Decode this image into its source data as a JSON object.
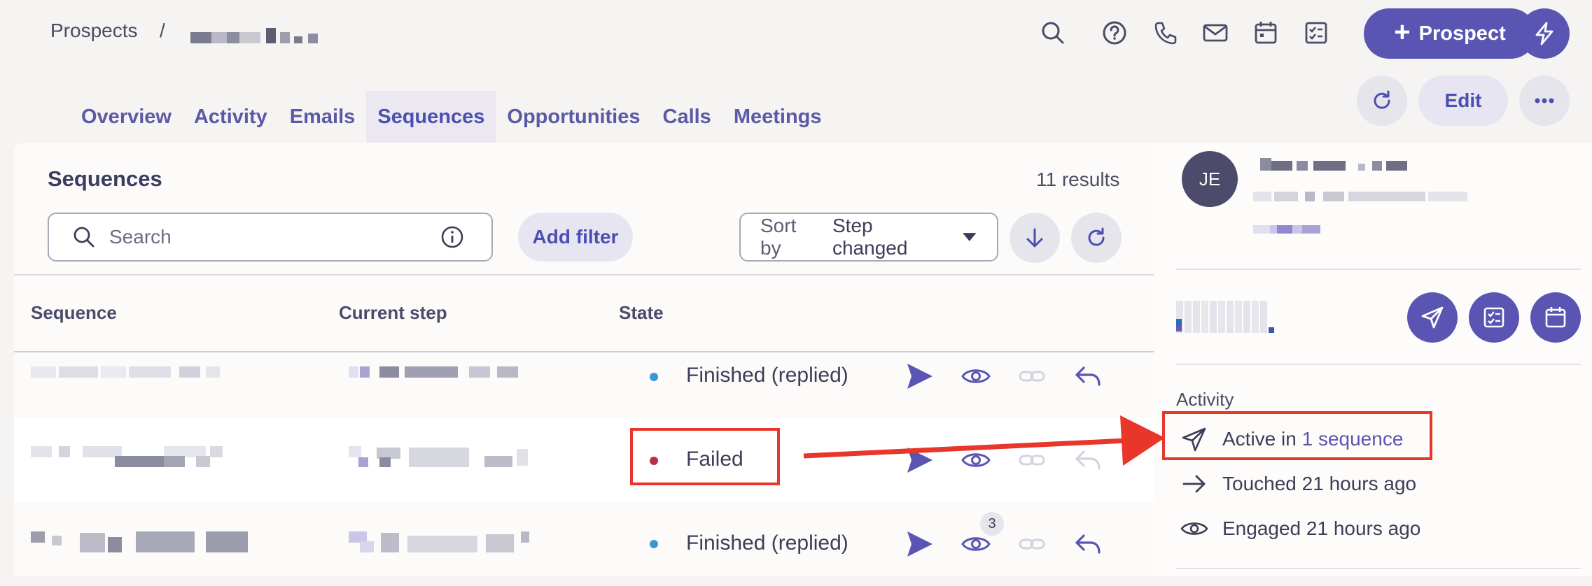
{
  "breadcrumb": {
    "parent": "Prospects",
    "separator": "/"
  },
  "header": {
    "prospect_button": "Prospect",
    "edit_button": "Edit"
  },
  "tabs": [
    {
      "label": "Overview"
    },
    {
      "label": "Activity"
    },
    {
      "label": "Emails"
    },
    {
      "label": "Sequences",
      "active": true
    },
    {
      "label": "Opportunities"
    },
    {
      "label": "Calls"
    },
    {
      "label": "Meetings"
    }
  ],
  "sequences": {
    "title": "Sequences",
    "results": "11 results",
    "search_placeholder": "Search",
    "add_filter": "Add filter",
    "sort_label": "Sort by",
    "sort_value": "Step changed",
    "columns": {
      "sequence": "Sequence",
      "current_step": "Current step",
      "state": "State"
    },
    "rows": [
      {
        "state": "Finished (replied)",
        "dot_color": "#3b98d4"
      },
      {
        "state": "Failed",
        "dot_color": "#b0334a"
      },
      {
        "state": "Finished (replied)",
        "dot_color": "#3b98d4",
        "views_badge": "3"
      }
    ]
  },
  "contact": {
    "initials": "JE",
    "activity_label": "Activity",
    "active_prefix": "Active in",
    "active_link": "1 sequence",
    "touched": "Touched 21 hours ago",
    "engaged": "Engaged 21 hours ago"
  },
  "colors": {
    "accent": "#5a55b2",
    "annotation": "#e8362a"
  }
}
